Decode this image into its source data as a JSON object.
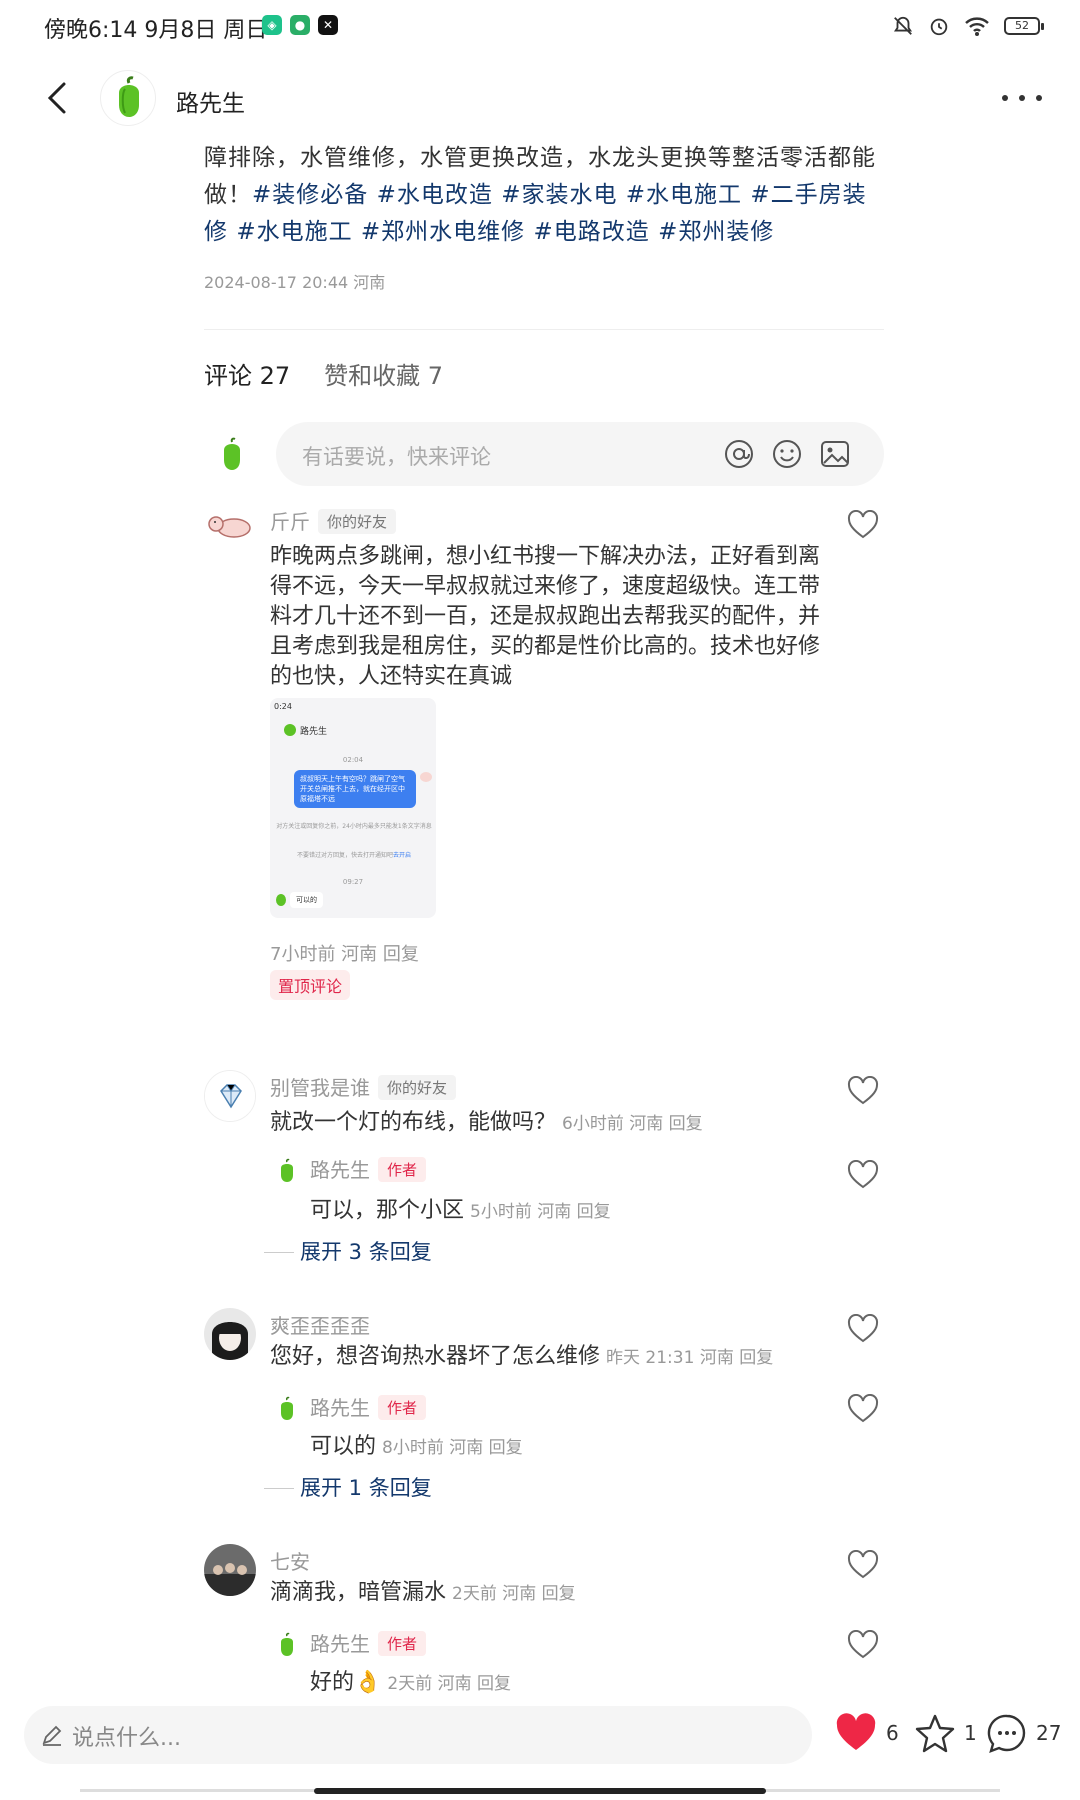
{
  "status_bar": {
    "time": "傍晚6:14 9月8日 周日",
    "battery": "52"
  },
  "header": {
    "author_name": "路先生"
  },
  "post": {
    "text_plain": "障排除，水管维修，水管更换改造，水龙头更换等整活零活都能做！",
    "hashtags": [
      "#装修必备",
      "#水电改造",
      "#家装水电",
      "#水电施工",
      "#二手房装修",
      "#水电施工",
      "#郑州水电维修",
      "#电路改造",
      "#郑州装修"
    ],
    "meta": "2024-08-17 20:44 河南"
  },
  "tabs": {
    "comments": "评论 27",
    "likes": "赞和收藏 7"
  },
  "comment_input": {
    "placeholder": "有话要说，快来评论"
  },
  "comments": [
    {
      "name": "斤斤",
      "badge": "你的好友",
      "text": "昨晚两点多跳闸，想小红书搜一下解决办法，正好看到离得不远，今天一早叔叔就过来修了，速度超级快。连工带料才几十还不到一百，还是叔叔跑出去帮我买的配件，并且考虑到我是租房住，买的都是性价比高的。技术也好修的也快，人还特实在真诚",
      "meta": "7小时前  河南 回复",
      "pin": "置顶评论",
      "image": {
        "time": "0:24",
        "title": "路先生",
        "ts1": "02:04",
        "bubble": "叔叔明天上午有空吗？跳闸了空气开关总闸推不上去，就在经开区中原福塔不远",
        "notice1": "对方关注或回复你之前，24小时内最多只能发1条文字消息",
        "notice2": "不要错过对方回复，快去打开通知吧",
        "notice_link": "去开启",
        "ts2": "09:27",
        "reply": "可以的"
      }
    },
    {
      "name": "别管我是谁",
      "badge": "你的好友",
      "text": "就改一个灯的布线，能做吗？",
      "time": "6小时前  河南 回复",
      "reply": {
        "name": "路先生",
        "badge": "作者",
        "text": "可以，那个小区",
        "time": "5小时前  河南 回复"
      },
      "expand": "展开 3 条回复"
    },
    {
      "name": "爽歪歪歪歪",
      "text": "您好，想咨询热水器坏了怎么维修",
      "time": "昨天 21:31  河南 回复",
      "reply": {
        "name": "路先生",
        "badge": "作者",
        "text": "可以的",
        "time": "8小时前  河南 回复"
      },
      "expand": "展开 1 条回复"
    },
    {
      "name": "七安",
      "text": "滴滴我，暗管漏水",
      "time": "2天前  河南 回复",
      "reply": {
        "name": "路先生",
        "badge": "作者",
        "text": "好的👌",
        "time": "2天前  河南 回复"
      }
    }
  ],
  "bottom_bar": {
    "placeholder": "说点什么...",
    "likes": "6",
    "stars": "1",
    "comments": "27"
  },
  "colors": {
    "hashtag": "#13386c",
    "like_red": "#ee2746",
    "author_badge": "#e0264a"
  }
}
